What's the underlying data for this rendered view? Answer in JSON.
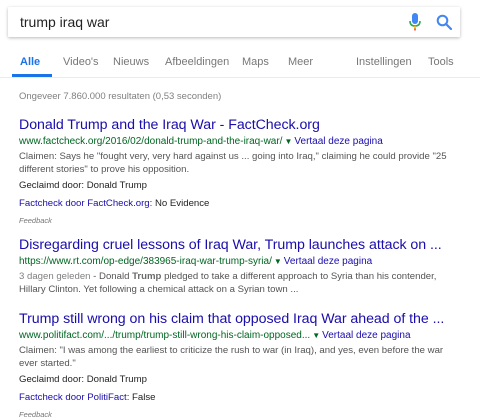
{
  "search": {
    "query": "trump iraq war"
  },
  "tabs": [
    {
      "label": "Alle",
      "active": true
    },
    {
      "label": "Video's"
    },
    {
      "label": "Nieuws"
    },
    {
      "label": "Afbeeldingen"
    },
    {
      "label": "Maps"
    },
    {
      "label": "Meer"
    },
    {
      "label": "Instellingen"
    },
    {
      "label": "Tools"
    }
  ],
  "stats": "Ongeveer 7.860.000 resultaten (0,53 seconden)",
  "colors": {
    "link": "#1a0dab",
    "url": "#006621",
    "accent": "#1a73e8",
    "mic_blue": "#4285f4"
  },
  "results": [
    {
      "title": "Donald Trump and the Iraq War - FactCheck.org",
      "url": "www.factcheck.org/2016/02/donald-trump-and-the-iraq-war/",
      "translate": "Vertaal deze pagina",
      "snippet_line1": "Claimen: Says he \"fought very, very hard against us ... going into Iraq,\" claiming he could provide \"25",
      "snippet_line2": "different stories\" to prove his opposition.",
      "claimed_by": "Geclaimd door: Donald Trump",
      "factcheck_link": "Factcheck door FactCheck.org",
      "factcheck_verdict": ": No Evidence",
      "feedback": "Feedback"
    },
    {
      "title": "Disregarding cruel lessons of Iraq War, Trump launches attack on ...",
      "url": "https://www.rt.com/op-edge/383965-iraq-war-trump-syria/",
      "translate": "Vertaal deze pagina",
      "date": "3 dagen geleden",
      "snippet_pre": " - Donald ",
      "snippet_bold": "Trump",
      "snippet_post": " pledged to take a different approach to Syria than his contender,",
      "snippet_line2": "Hillary Clinton. Yet following a chemical attack on a Syrian town ..."
    },
    {
      "title": "Trump still wrong on his claim that opposed Iraq War ahead of the ...",
      "url": "www.politifact.com/.../trump/trump-still-wrong-his-claim-opposed...",
      "translate": "Vertaal deze pagina",
      "snippet_line1": "Claimen: \"I was among the earliest to criticize the rush to war (in Iraq), and yes, even before the war",
      "snippet_line2": "ever started.\"",
      "claimed_by": "Geclaimd door: Donald Trump",
      "factcheck_link": "Factcheck door PolitiFact",
      "factcheck_verdict": ": False",
      "feedback": "Feedback"
    }
  ]
}
